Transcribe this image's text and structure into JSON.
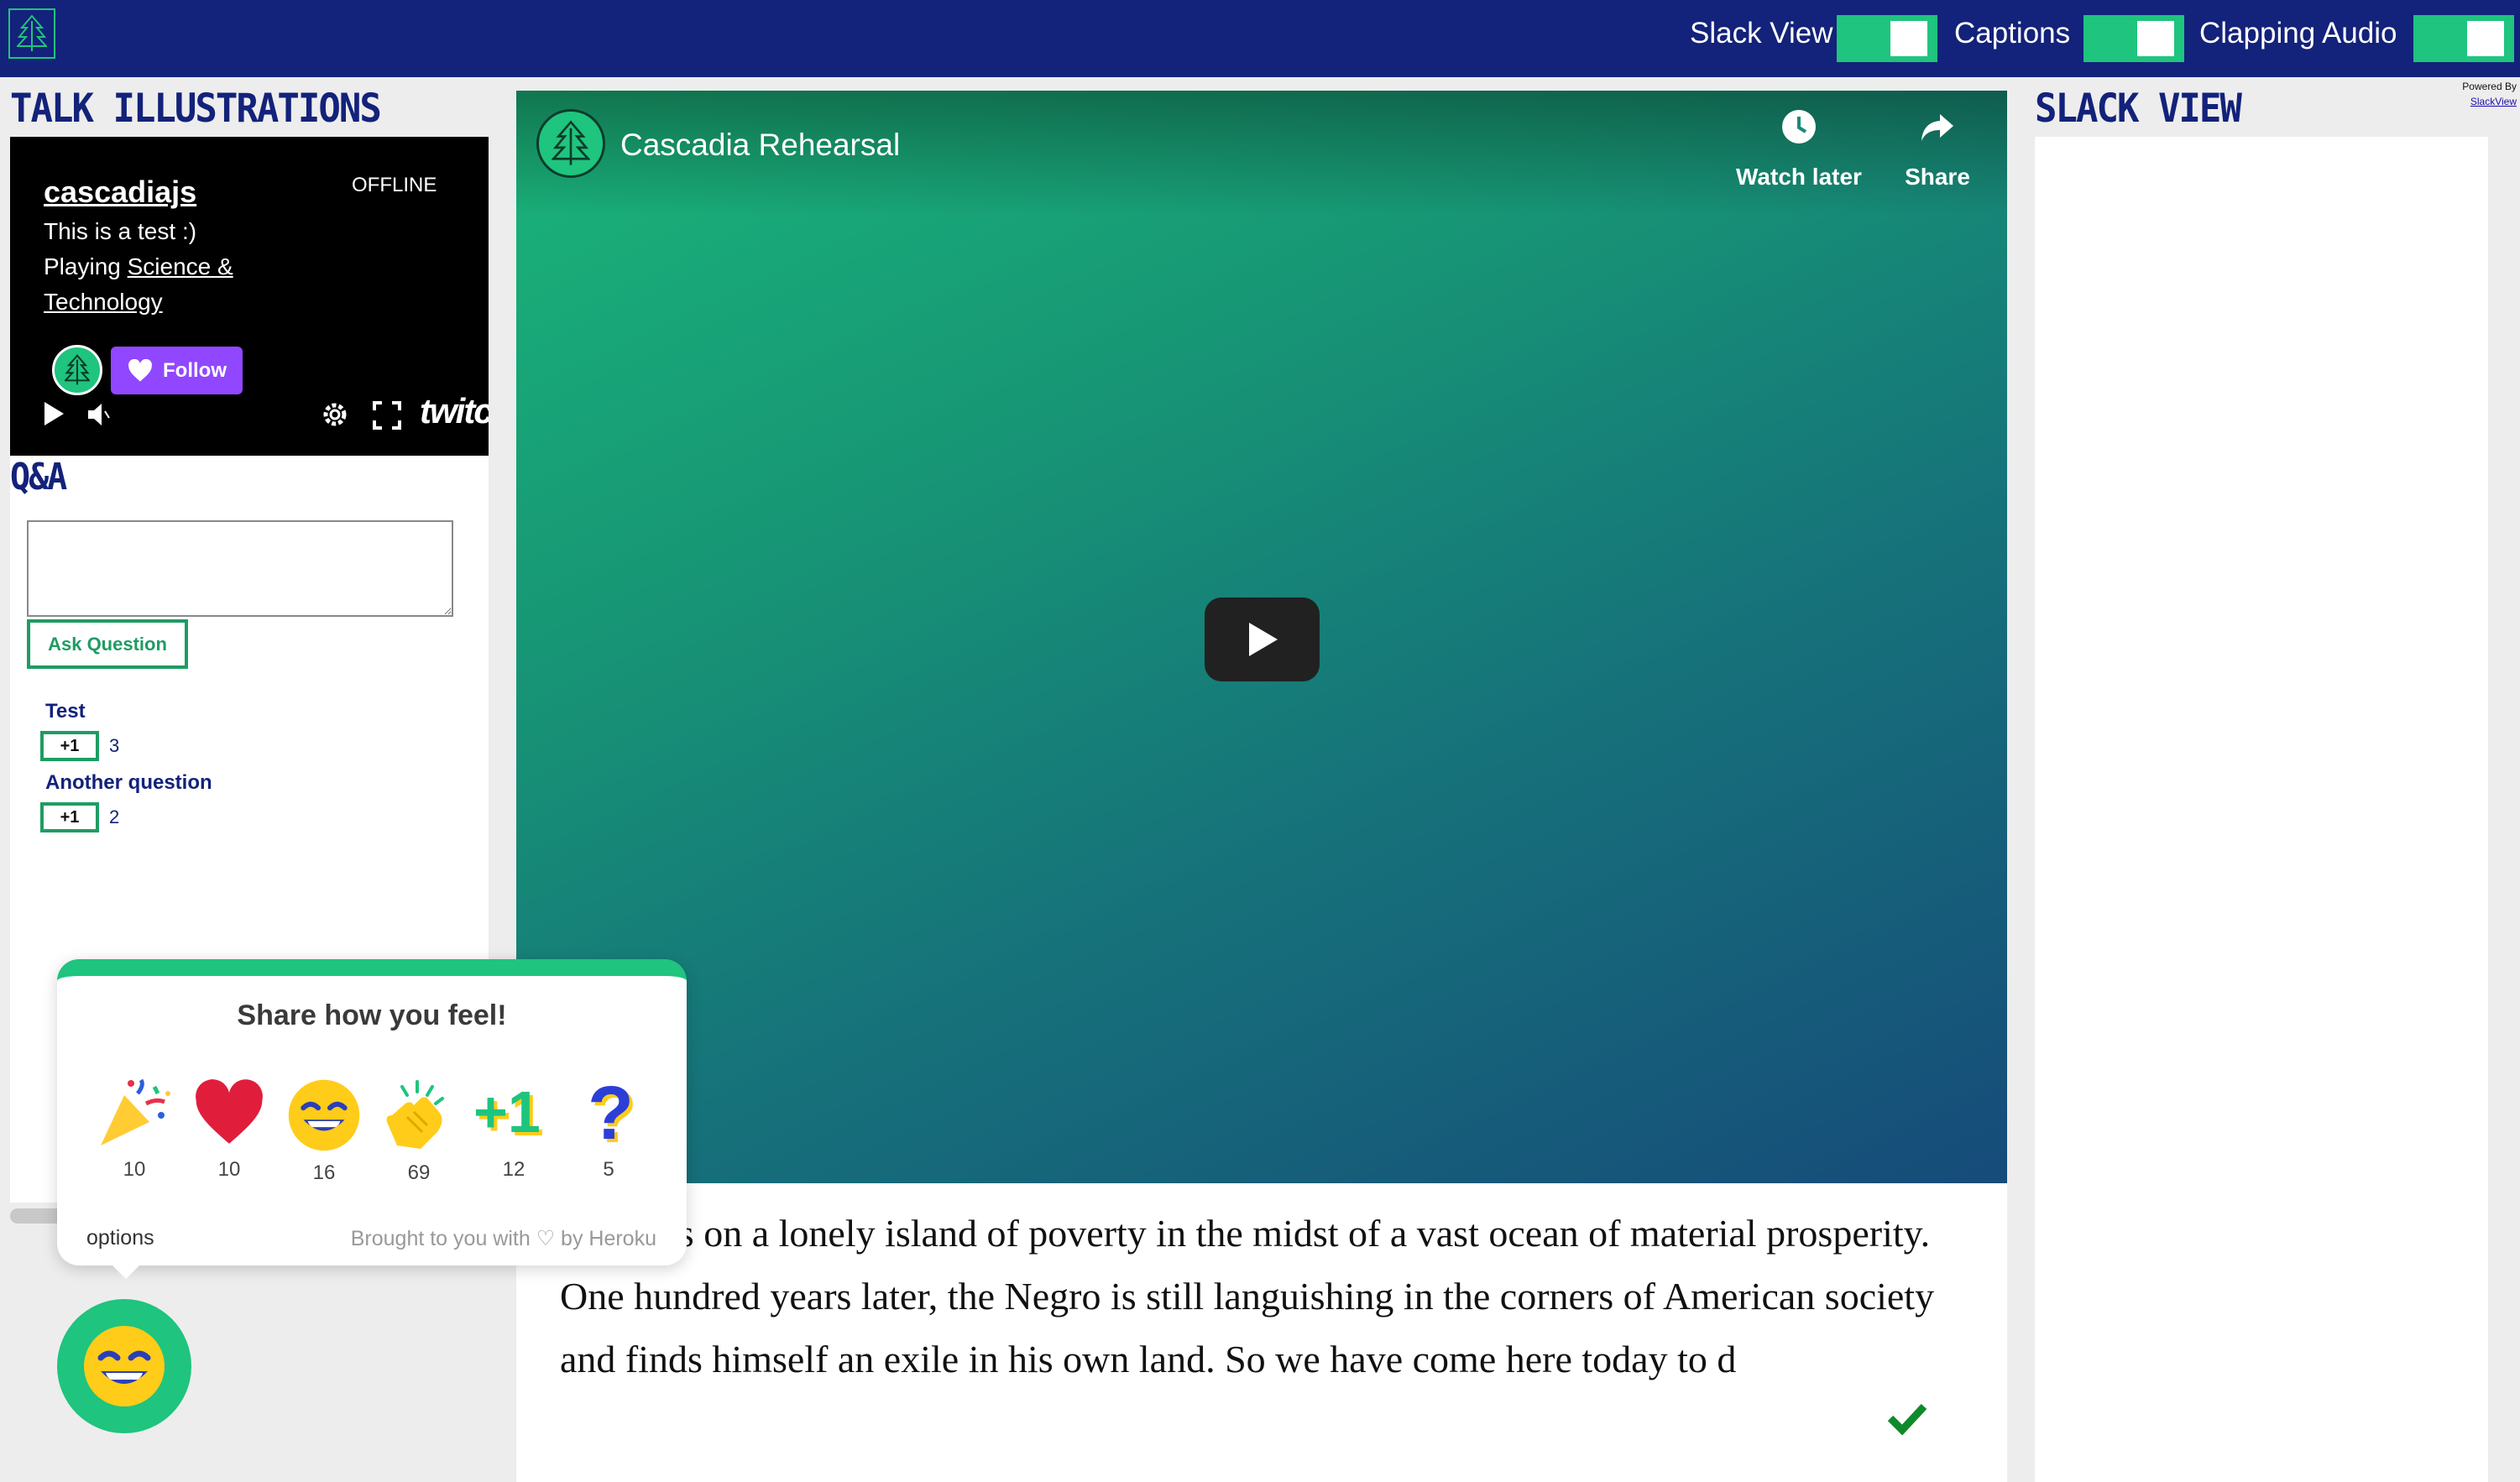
{
  "topbar": {
    "logo_icon": "tree-icon",
    "toggles": [
      {
        "label": "Slack View",
        "on": true
      },
      {
        "label": "Captions",
        "on": true
      },
      {
        "label": "Clapping Audio",
        "on": true
      }
    ],
    "accent": "#1fc47e",
    "bg": "#13227a"
  },
  "powered": {
    "line1": "Powered By",
    "link": "SlackView"
  },
  "left": {
    "title": "TALK ILLUSTRATIONS",
    "twitch": {
      "channel": "cascadiajs",
      "status": "OFFLINE",
      "line1": "This is a test :)",
      "line2_prefix": "Playing ",
      "line2_link": "Science &",
      "line3": "Technology",
      "follow_label": "Follow",
      "brand": "twitch"
    },
    "qa_title": "Q&A",
    "ask_label": "Ask Question",
    "questions": [
      {
        "text": "Test",
        "vote_label": "+1",
        "votes": "3"
      },
      {
        "text": "Another question",
        "vote_label": "+1",
        "votes": "2"
      }
    ]
  },
  "video": {
    "title": "Cascadia Rehearsal",
    "watch_later": "Watch later",
    "share": "Share"
  },
  "captions": {
    "text": "gro lives on a lonely island of poverty in the midst of a vast ocean of material prosperity. One hundred years later, the Negro is still languishing in the corners of American society and finds himself an exile in his own land. So we have come here today to d"
  },
  "slack": {
    "title": "SLACK VIEW"
  },
  "feel": {
    "title": "Share how you feel!",
    "reactions": [
      {
        "icon": "party-popper-icon",
        "count": "10"
      },
      {
        "icon": "heart-icon",
        "count": "10"
      },
      {
        "icon": "grin-icon",
        "count": "16"
      },
      {
        "icon": "clap-icon",
        "count": "69"
      },
      {
        "icon": "plus-one-icon",
        "count": "12"
      },
      {
        "icon": "question-icon",
        "count": "5"
      }
    ],
    "options": "options",
    "brought": "Brought to you with ♡ by Heroku"
  }
}
